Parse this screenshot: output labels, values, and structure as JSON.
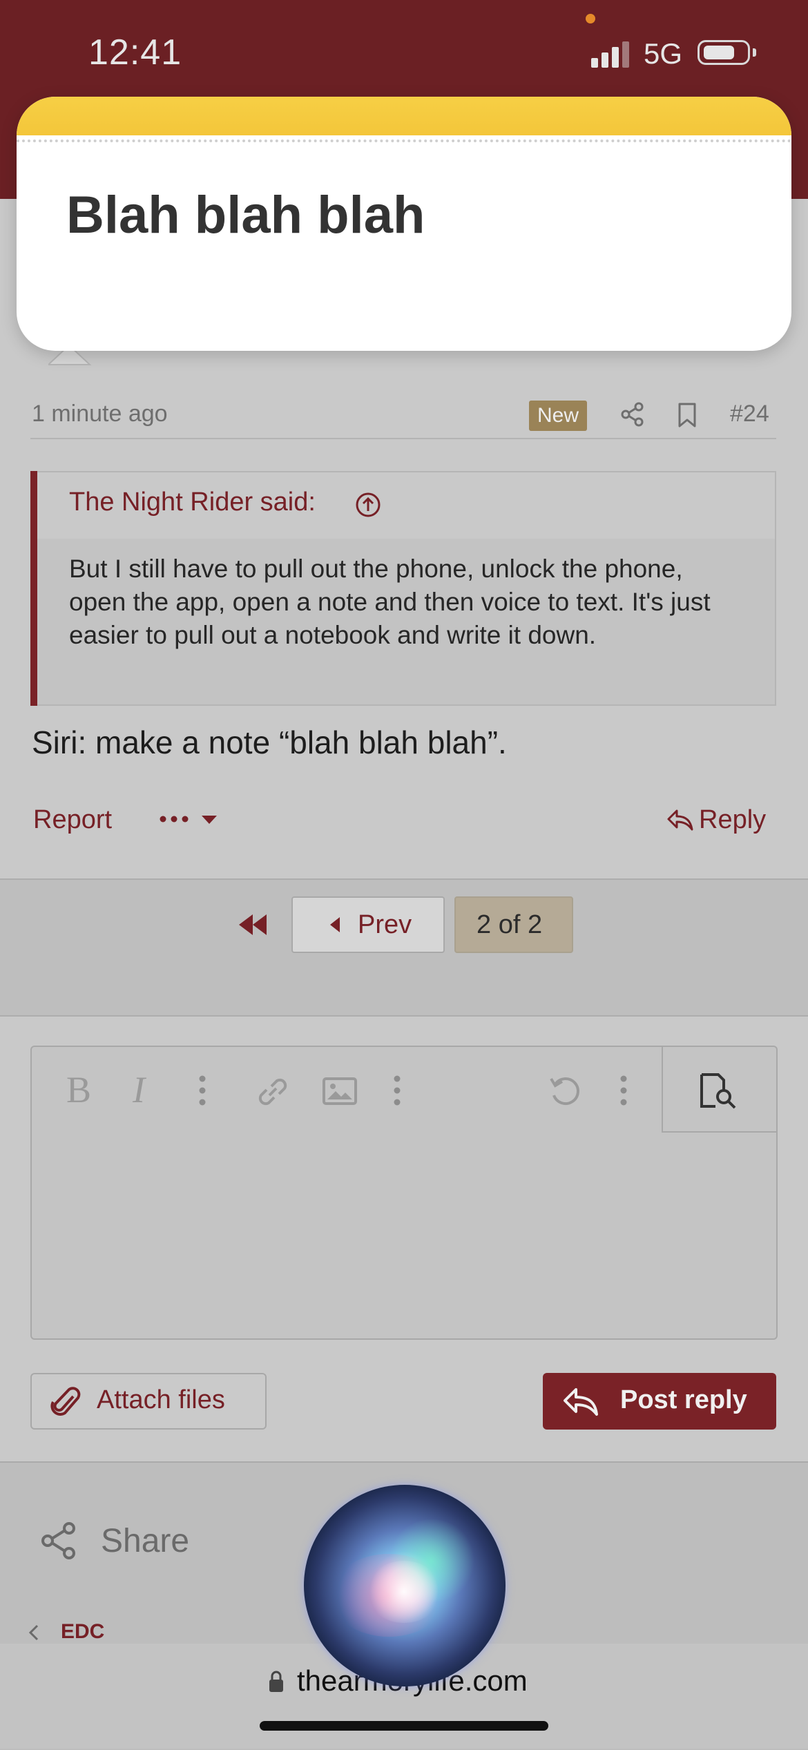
{
  "status_bar": {
    "time": "12:41",
    "network": "5G"
  },
  "note_card": {
    "text": "Blah blah blah"
  },
  "post": {
    "time": "1 minute ago",
    "badge": "New",
    "number": "#24",
    "quote": {
      "author": "The Night Rider said:",
      "text": "But I still have to pull out the phone, unlock the phone, open the app, open a note and then voice to text. It's just easier to pull out a notebook and write it down."
    },
    "body": "Siri: make a note “blah blah blah”.",
    "actions": {
      "report": "Report",
      "reply": "Reply"
    }
  },
  "pagination": {
    "prev": "Prev",
    "current": "2 of 2"
  },
  "editor": {
    "toolbar": [
      "bold-icon",
      "italic-icon",
      "more-vertical-icon",
      "link-icon",
      "image-icon",
      "more-vertical-icon",
      "undo-icon",
      "more-vertical-icon",
      "preview-icon"
    ]
  },
  "reply_actions": {
    "attach": "Attach files",
    "post": "Post reply"
  },
  "footer": {
    "share": "Share",
    "breadcrumb": "EDC"
  },
  "browser": {
    "url": "thearmorylife.com"
  },
  "colors": {
    "header": "#6b2024",
    "accent": "#762026",
    "badge": "#9a8357",
    "note_yellow": "#f4c63a"
  }
}
